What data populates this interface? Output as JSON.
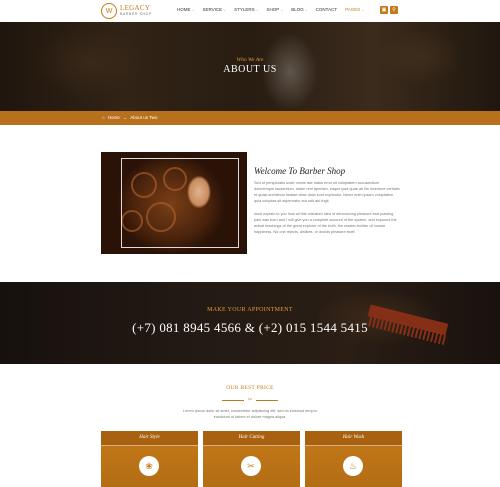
{
  "header": {
    "logo": {
      "name": "LEGACY",
      "sub": "BARBER SHOP",
      "mark": "W"
    },
    "nav": [
      {
        "label": "HOME",
        "caret": true
      },
      {
        "label": "SERVICE",
        "caret": true
      },
      {
        "label": "STYLERS",
        "caret": true
      },
      {
        "label": "SHOP",
        "caret": true
      },
      {
        "label": "BLOG",
        "caret": true
      },
      {
        "label": "CONTACT",
        "caret": false
      },
      {
        "label": "PAGES",
        "caret": true
      }
    ],
    "active_nav": "PAGES",
    "icons": [
      "cart-icon",
      "search-icon"
    ]
  },
  "hero": {
    "kicker": "Who We Are",
    "title": "ABOUT US"
  },
  "breadcrumb": {
    "home": "Home",
    "current": "About us Two"
  },
  "about": {
    "title": "Welcome To Barber Shop",
    "para1": "Sed ut perspiciatis unde omnis iste natus error sit voluptatem accusantium doloremque laudantium, totam rem aperiam, eaque ipsa quae ab illo inventore veritatis et quasi architecto beatae vitae dicta sunt explicabo. Nemo enim ipsam voluptatem quia voluptas sit aspernatur aut odit aut fugit.",
    "para2": "must explain to you how all this mistaken idea of denouncing pleasure and praising pain was born and I will give you a complete account of the system, and expound the actual teachings of the great explorer of the truth, the master-builder of human happiness. No one rejects, dislikes, or avoids pleasure itself."
  },
  "appointment": {
    "kicker": "MAKE YOUR APPOINTMENT",
    "phone": "(+7) 081 8945 4566 & (+2) 015 1544 5415"
  },
  "price": {
    "kicker": "OUR BEST PRICE",
    "desc": "Lorem ipsum dolor sit amet, consectetur adipisicing elit, sed do eiusmod tempor incididunt ut labore et dolore magna aliqua.",
    "cards": [
      {
        "title": "Hair Style",
        "icon": "hair-style-icon"
      },
      {
        "title": "Hair Cutting",
        "icon": "barber-chair-icon"
      },
      {
        "title": "Hair Wash",
        "icon": "hair-wash-icon"
      }
    ]
  },
  "colors": {
    "accent": "#c47a18",
    "breadcrumb_bar": "#b9701c",
    "dark": "#2a1f15"
  }
}
